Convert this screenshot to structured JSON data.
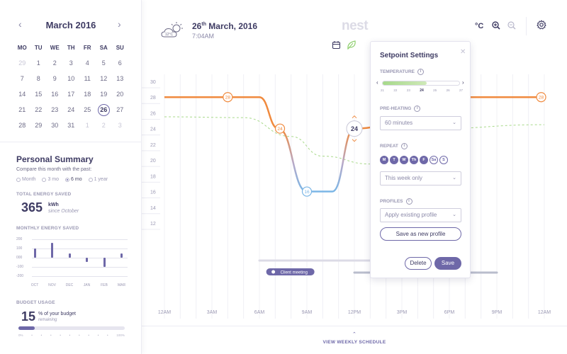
{
  "calendar": {
    "month": "March 2016",
    "prev_icon": "chevron-left-icon",
    "next_icon": "chevron-right-icon",
    "weekdays": [
      "MO",
      "TU",
      "WE",
      "TH",
      "FR",
      "SA",
      "SU"
    ],
    "days": [
      {
        "d": "29",
        "muted": true
      },
      {
        "d": "1"
      },
      {
        "d": "2"
      },
      {
        "d": "3"
      },
      {
        "d": "4"
      },
      {
        "d": "5"
      },
      {
        "d": "6"
      },
      {
        "d": "7"
      },
      {
        "d": "8"
      },
      {
        "d": "9"
      },
      {
        "d": "10"
      },
      {
        "d": "11"
      },
      {
        "d": "12"
      },
      {
        "d": "13"
      },
      {
        "d": "14"
      },
      {
        "d": "15"
      },
      {
        "d": "16"
      },
      {
        "d": "17"
      },
      {
        "d": "18"
      },
      {
        "d": "19"
      },
      {
        "d": "20"
      },
      {
        "d": "21"
      },
      {
        "d": "22"
      },
      {
        "d": "23"
      },
      {
        "d": "24"
      },
      {
        "d": "25"
      },
      {
        "d": "26",
        "selected": true
      },
      {
        "d": "27"
      },
      {
        "d": "28"
      },
      {
        "d": "29"
      },
      {
        "d": "30"
      },
      {
        "d": "31"
      },
      {
        "d": "1",
        "muted": true
      },
      {
        "d": "2",
        "muted": true
      },
      {
        "d": "3",
        "muted": true
      }
    ]
  },
  "summary": {
    "title": "Personal Summary",
    "compare_text": "Compare this month with the past:",
    "options": [
      {
        "label": "Month",
        "checked": false
      },
      {
        "label": "3 mo",
        "checked": false
      },
      {
        "label": "6 mo",
        "checked": true
      },
      {
        "label": "1 year",
        "checked": false
      }
    ],
    "total_label": "TOTAL ENERGY SAVED",
    "total_value": "365",
    "total_unit": "kWh",
    "total_since": "since October",
    "monthly_label": "MONTHLY ENERGY SAVED",
    "monthly_chart": {
      "y_ticks": [
        "200",
        "100",
        "000",
        "-100",
        "-200"
      ],
      "months": [
        "OCT",
        "NOV",
        "DEC",
        "JAN",
        "FEB",
        "MAR"
      ],
      "values": [
        100,
        160,
        50,
        -45,
        -100,
        45
      ]
    },
    "budget_label": "BUDGET USAGE",
    "budget_value": "15",
    "budget_text": "% of your budget",
    "budget_sub": "remaining",
    "budget_fraction": 0.15,
    "budget_ticks": [
      "0%",
      "",
      "",
      "",
      "",
      "",
      "",
      "",
      "",
      "",
      "100%"
    ]
  },
  "header": {
    "weather_temp": "12°C",
    "weather_icon": "partly-cloudy-icon",
    "date_day": "26",
    "date_suffix": "th",
    "date_rest": " March, 2016",
    "time": "7:04AM",
    "logo": "nest",
    "unit": "°C",
    "zoom_in_icon": "zoom-in-icon",
    "zoom_out_icon": "zoom-out-icon",
    "settings_icon": "gear-icon",
    "calendar_icon": "calendar-icon",
    "leaf_icon": "leaf-icon"
  },
  "chart_data": {
    "type": "line",
    "y_ticks": [
      30,
      28,
      26,
      24,
      22,
      20,
      18,
      16,
      14,
      12
    ],
    "x_labels": [
      "12AM",
      "3AM",
      "6AM",
      "9AM",
      "12PM",
      "3PM",
      "6PM",
      "9PM",
      "12AM"
    ],
    "series": [
      {
        "style": "solid",
        "color": "#f08a3e",
        "points": [
          [
            0,
            28
          ],
          [
            6,
            28
          ],
          [
            7.2,
            24
          ],
          [
            9,
            16
          ],
          [
            10.6,
            16
          ],
          [
            12,
            24
          ],
          [
            18.7,
            28
          ],
          [
            24,
            28
          ]
        ]
      },
      {
        "style": "dashed",
        "color": "#a8d98a",
        "points": [
          [
            0,
            25.5
          ],
          [
            5,
            25.4
          ],
          [
            8,
            23
          ],
          [
            10,
            20.5
          ],
          [
            13,
            19.5
          ],
          [
            17,
            24
          ],
          [
            24,
            24.5
          ]
        ]
      }
    ],
    "markers": [
      {
        "label": "28",
        "x": 4,
        "y": 28
      },
      {
        "label": "24",
        "x": 7.3,
        "y": 24
      },
      {
        "label": "16",
        "x": 9,
        "y": 16
      },
      {
        "label": "24",
        "x": 12,
        "y": 24,
        "active": true
      },
      {
        "label": "28",
        "x": 23.8,
        "y": 28
      }
    ],
    "schedule_bars": [
      {
        "start": 6,
        "end": 13
      },
      {
        "start": 12,
        "end": 21
      }
    ],
    "events": [
      {
        "label": "Client meeting",
        "x": 6.7
      }
    ]
  },
  "bottom": {
    "weekly_label": "VIEW WEEKLY SCHEDULE",
    "caret_icon": "chevron-up-icon"
  },
  "popover": {
    "title": "Setpoint Settings",
    "close_icon": "close-icon",
    "temperature_label": "TEMPERATURE",
    "temp_ticks": [
      "21",
      "22",
      "23",
      "24",
      "25",
      "26",
      "27"
    ],
    "temp_selected": "24",
    "preheat_label": "PRE-HEATING",
    "preheat_value": "60 minutes",
    "repeat_label": "REPEAT",
    "days": [
      {
        "l": "M",
        "on": true
      },
      {
        "l": "T",
        "on": true
      },
      {
        "l": "W",
        "on": true
      },
      {
        "l": "Th",
        "on": true
      },
      {
        "l": "F",
        "on": true
      },
      {
        "l": "Sa",
        "on": false
      },
      {
        "l": "S",
        "on": false
      }
    ],
    "repeat_value": "This week only",
    "profiles_label": "PROFILES",
    "profiles_value": "Apply existing profile",
    "save_profile": "Save as new profile",
    "delete": "Delete",
    "save": "Save"
  }
}
